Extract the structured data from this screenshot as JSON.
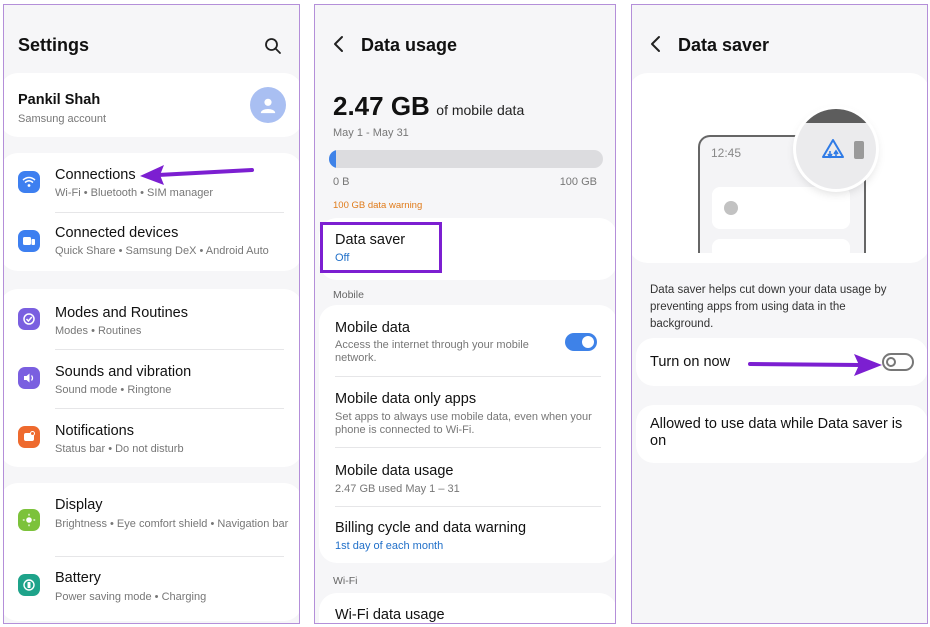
{
  "settings": {
    "title": "Settings",
    "account": {
      "name": "Pankil Shah",
      "sub": "Samsung account"
    },
    "items": [
      {
        "title": "Connections",
        "sub": "Wi-Fi  •  Bluetooth  •  SIM manager"
      },
      {
        "title": "Connected devices",
        "sub": "Quick Share  •  Samsung DeX  •  Android Auto"
      },
      {
        "title": "Modes and Routines",
        "sub": "Modes  •  Routines"
      },
      {
        "title": "Sounds and vibration",
        "sub": "Sound mode  •  Ringtone"
      },
      {
        "title": "Notifications",
        "sub": "Status bar  •  Do not disturb"
      },
      {
        "title": "Display",
        "sub": "Brightness  •  Eye comfort shield  •  Navigation bar"
      },
      {
        "title": "Battery",
        "sub": "Power saving mode  •  Charging"
      }
    ]
  },
  "data_usage": {
    "title": "Data usage",
    "amount": "2.47 GB",
    "amount_suffix": "of mobile data",
    "period": "May 1 - May 31",
    "usage_fraction": 0.0247,
    "bar_min": "0 B",
    "bar_max": "100 GB",
    "warning": "100 GB data warning",
    "data_saver": {
      "title": "Data saver",
      "status": "Off"
    },
    "section_mobile": "Mobile",
    "mobile_data": {
      "title": "Mobile data",
      "sub": "Access the internet through your mobile network."
    },
    "mobile_only_apps": {
      "title": "Mobile data only apps",
      "sub": "Set apps to always use mobile data, even when your phone is connected to Wi-Fi."
    },
    "mobile_usage": {
      "title": "Mobile data usage",
      "sub": "2.47 GB used May 1 – 31"
    },
    "billing": {
      "title": "Billing cycle and data warning",
      "sub": "1st day of each month"
    },
    "section_wifi": "Wi-Fi",
    "wifi_usage": {
      "title": "Wi-Fi data usage"
    }
  },
  "data_saver": {
    "title": "Data saver",
    "illustration_time": "12:45",
    "description": "Data saver helps cut down your data usage by preventing apps from using data in the background.",
    "turn_on_label": "Turn on now",
    "allowed_label": "Allowed to use data while Data saver is on"
  },
  "colors": {
    "annotation_purple": "#7c1fd1",
    "toggle_blue": "#3e82e8",
    "warning_orange": "#e07b1a",
    "link_blue": "#2170c9"
  },
  "icons": {
    "search": "search-icon",
    "avatar": "person-icon",
    "connections": "wifi-icon",
    "connected_devices": "devices-icon",
    "modes": "check-circle-icon",
    "sounds": "speaker-icon",
    "notifications": "bell-icon",
    "display": "sun-icon",
    "battery": "battery-icon",
    "back": "chevron-left-icon"
  }
}
